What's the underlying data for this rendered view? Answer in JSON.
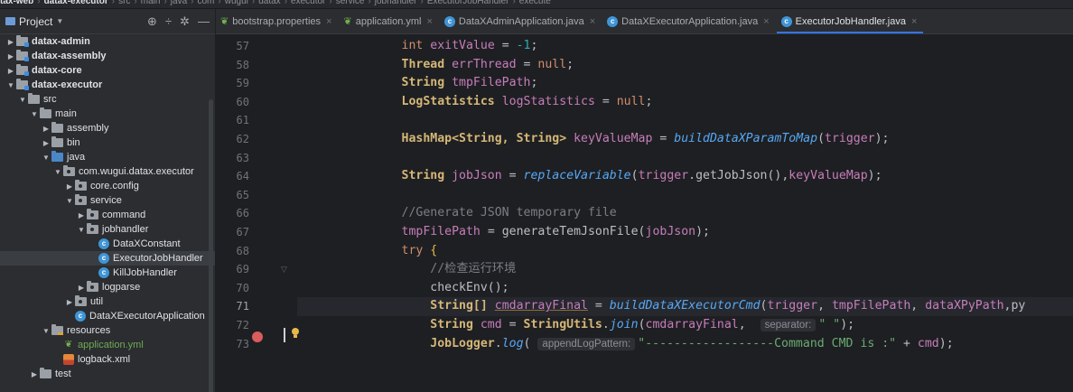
{
  "breadcrumb": [
    "tax-web",
    "datax-executor",
    "src",
    "main",
    "java",
    "com",
    "wugui",
    "datax",
    "executor",
    "service",
    "jobhandler",
    "ExecutorJobHandler",
    "execute"
  ],
  "project": {
    "title": "Project",
    "tree": [
      {
        "label": "datax-admin",
        "depth": 0,
        "arrow": "collapsed",
        "icon": "module-folder",
        "bold": true
      },
      {
        "label": "datax-assembly",
        "depth": 0,
        "arrow": "collapsed",
        "icon": "module-folder",
        "bold": true
      },
      {
        "label": "datax-core",
        "depth": 0,
        "arrow": "collapsed",
        "icon": "module-folder",
        "bold": true
      },
      {
        "label": "datax-executor",
        "depth": 0,
        "arrow": "expanded",
        "icon": "module-folder",
        "bold": true
      },
      {
        "label": "src",
        "depth": 1,
        "arrow": "expanded",
        "icon": "folder"
      },
      {
        "label": "main",
        "depth": 2,
        "arrow": "expanded",
        "icon": "folder"
      },
      {
        "label": "assembly",
        "depth": 3,
        "arrow": "collapsed",
        "icon": "folder"
      },
      {
        "label": "bin",
        "depth": 3,
        "arrow": "collapsed",
        "icon": "folder"
      },
      {
        "label": "java",
        "depth": 3,
        "arrow": "expanded",
        "icon": "source-folder"
      },
      {
        "label": "com.wugui.datax.executor",
        "depth": 4,
        "arrow": "expanded",
        "icon": "package-folder"
      },
      {
        "label": "core.config",
        "depth": 5,
        "arrow": "collapsed",
        "icon": "package-folder"
      },
      {
        "label": "service",
        "depth": 5,
        "arrow": "expanded",
        "icon": "package-folder"
      },
      {
        "label": "command",
        "depth": 6,
        "arrow": "collapsed",
        "icon": "package-folder"
      },
      {
        "label": "jobhandler",
        "depth": 6,
        "arrow": "expanded",
        "icon": "package-folder"
      },
      {
        "label": "DataXConstant",
        "depth": 7,
        "arrow": "none",
        "icon": "class"
      },
      {
        "label": "ExecutorJobHandler",
        "depth": 7,
        "arrow": "none",
        "icon": "class",
        "selected": true
      },
      {
        "label": "KillJobHandler",
        "depth": 7,
        "arrow": "none",
        "icon": "class"
      },
      {
        "label": "logparse",
        "depth": 6,
        "arrow": "collapsed",
        "icon": "package-folder"
      },
      {
        "label": "util",
        "depth": 5,
        "arrow": "collapsed",
        "icon": "package-folder"
      },
      {
        "label": "DataXExecutorApplication",
        "depth": 5,
        "arrow": "none",
        "icon": "class"
      },
      {
        "label": "resources",
        "depth": 3,
        "arrow": "expanded",
        "icon": "resources-folder"
      },
      {
        "label": "application.yml",
        "depth": 4,
        "arrow": "none",
        "icon": "yml-leaf",
        "green": true
      },
      {
        "label": "logback.xml",
        "depth": 4,
        "arrow": "none",
        "icon": "xml-file"
      },
      {
        "label": "test",
        "depth": 2,
        "arrow": "collapsed",
        "icon": "folder"
      }
    ]
  },
  "tabs": [
    {
      "label": "bootstrap.properties",
      "icon": "leaf-icon",
      "active": false
    },
    {
      "label": "application.yml",
      "icon": "leaf-icon",
      "active": false
    },
    {
      "label": "DataXAdminApplication.java",
      "icon": "class-icon",
      "active": false
    },
    {
      "label": "DataXExecutorApplication.java",
      "icon": "class-icon",
      "active": false
    },
    {
      "label": "ExecutorJobHandler.java",
      "icon": "class-icon",
      "active": true
    }
  ],
  "editor": {
    "current_line": 71,
    "breakpoint_line": 71,
    "lines": [
      {
        "n": "57",
        "tokens": [
          [
            "ind",
            "        "
          ],
          [
            "kw",
            "int "
          ],
          [
            "var",
            "exitValue"
          ],
          [
            "",
            " = "
          ],
          [
            "num",
            "-1"
          ],
          [
            "",
            ";"
          ]
        ]
      },
      {
        "n": "58",
        "tokens": [
          [
            "ind",
            "        "
          ],
          [
            "ty",
            "Thread "
          ],
          [
            "var",
            "errThread"
          ],
          [
            "",
            " = "
          ],
          [
            "kw",
            "null"
          ],
          [
            "",
            ";"
          ]
        ]
      },
      {
        "n": "59",
        "tokens": [
          [
            "ind",
            "        "
          ],
          [
            "ty",
            "String "
          ],
          [
            "var",
            "tmpFilePath"
          ],
          [
            "",
            ";"
          ]
        ]
      },
      {
        "n": "60",
        "tokens": [
          [
            "ind",
            "        "
          ],
          [
            "ty",
            "LogStatistics "
          ],
          [
            "var",
            "logStatistics"
          ],
          [
            "",
            " = "
          ],
          [
            "kw",
            "null"
          ],
          [
            "",
            ";"
          ]
        ]
      },
      {
        "n": "61",
        "tokens": []
      },
      {
        "n": "62",
        "tokens": [
          [
            "ind",
            "        "
          ],
          [
            "ty",
            "HashMap<String, String> "
          ],
          [
            "var",
            "keyValueMap"
          ],
          [
            "",
            " = "
          ],
          [
            "fn",
            "buildDataXParamToMap"
          ],
          [
            "",
            "("
          ],
          [
            "var",
            "trigger"
          ],
          [
            "",
            ");"
          ]
        ]
      },
      {
        "n": "63",
        "tokens": []
      },
      {
        "n": "64",
        "tokens": [
          [
            "ind",
            "        "
          ],
          [
            "ty",
            "String "
          ],
          [
            "var",
            "jobJson"
          ],
          [
            "",
            " = "
          ],
          [
            "fn",
            "replaceVariable"
          ],
          [
            "",
            "("
          ],
          [
            "var",
            "trigger"
          ],
          [
            "",
            ".getJobJson(),"
          ],
          [
            "var",
            "keyValueMap"
          ],
          [
            "",
            ");"
          ]
        ]
      },
      {
        "n": "65",
        "tokens": []
      },
      {
        "n": "66",
        "tokens": [
          [
            "ind",
            "        "
          ],
          [
            "cm",
            "//Generate JSON temporary file"
          ]
        ]
      },
      {
        "n": "67",
        "tokens": [
          [
            "ind",
            "        "
          ],
          [
            "var",
            "tmpFilePath"
          ],
          [
            "",
            " = generateTemJsonFile("
          ],
          [
            "var",
            "jobJson"
          ],
          [
            "",
            ");"
          ]
        ]
      },
      {
        "n": "68",
        "tokens": [
          [
            "ind",
            "        "
          ],
          [
            "kw",
            "try "
          ],
          [
            "paren",
            "{"
          ]
        ]
      },
      {
        "n": "69",
        "tokens": [
          [
            "ind",
            "            "
          ],
          [
            "cm",
            "//检查运行环境"
          ]
        ]
      },
      {
        "n": "70",
        "tokens": [
          [
            "ind",
            "            "
          ],
          [
            "",
            "checkEnv();"
          ]
        ]
      },
      {
        "n": "71",
        "tokens": [
          [
            "ind",
            "            "
          ],
          [
            "ty",
            "String[] "
          ],
          [
            "warnvar",
            "cmdarrayFinal"
          ],
          [
            "",
            " = "
          ],
          [
            "fn",
            "buildDataXExecutorCmd"
          ],
          [
            "",
            "("
          ],
          [
            "var",
            "trigger"
          ],
          [
            "",
            ", "
          ],
          [
            "var",
            "tmpFilePath"
          ],
          [
            "",
            ", "
          ],
          [
            "fld",
            "dataXPyPath"
          ],
          [
            "",
            ",py"
          ]
        ]
      },
      {
        "n": "72",
        "tokens": [
          [
            "ind",
            "            "
          ],
          [
            "ty",
            "String "
          ],
          [
            "var",
            "cmd"
          ],
          [
            "",
            " = "
          ],
          [
            "ty",
            "StringUtils"
          ],
          [
            "",
            "."
          ],
          [
            "fn",
            "join"
          ],
          [
            "",
            "("
          ],
          [
            "var",
            "cmdarrayFinal"
          ],
          [
            "",
            ",  "
          ],
          [
            "hint",
            "separator:"
          ],
          [
            "str",
            "\" \""
          ],
          [
            "",
            ");"
          ]
        ]
      },
      {
        "n": "73",
        "tokens": [
          [
            "ind",
            "            "
          ],
          [
            "ty",
            "JobLogger"
          ],
          [
            "",
            "."
          ],
          [
            "fn",
            "log"
          ],
          [
            "",
            "( "
          ],
          [
            "hint",
            "appendLogPattern:"
          ],
          [
            "str",
            "\"------------------Command CMD is :\""
          ],
          [
            "",
            " + "
          ],
          [
            "var",
            "cmd"
          ],
          [
            "",
            ");"
          ]
        ]
      }
    ]
  }
}
